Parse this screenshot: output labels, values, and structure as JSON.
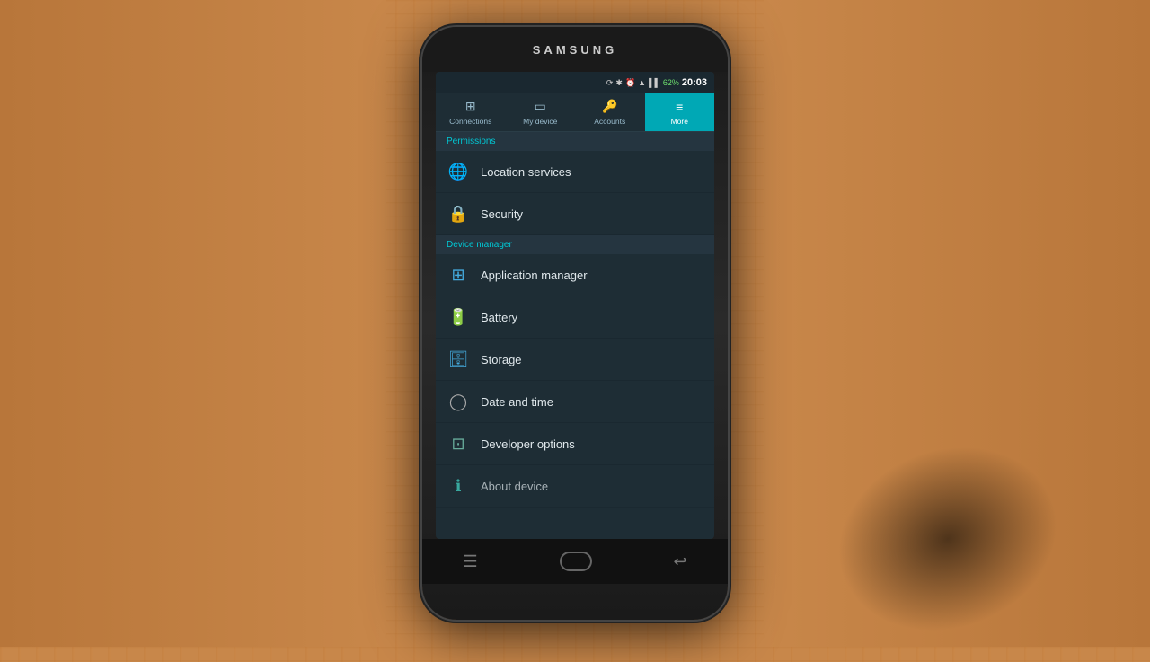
{
  "phone": {
    "brand": "SAMSUNG",
    "status_bar": {
      "time": "20:03",
      "battery": "62%",
      "icons": [
        "⊕",
        "✱",
        "◎",
        "▲",
        "▼"
      ]
    },
    "tabs": [
      {
        "id": "connections",
        "label": "Connections",
        "icon": "⊞",
        "active": false
      },
      {
        "id": "my_device",
        "label": "My device",
        "icon": "📱",
        "active": false
      },
      {
        "id": "accounts",
        "label": "Accounts",
        "icon": "🔑",
        "active": false
      },
      {
        "id": "more",
        "label": "More",
        "icon": "≡",
        "active": true
      }
    ],
    "sections": [
      {
        "header": "Permissions",
        "items": [
          {
            "id": "location",
            "label": "Location services",
            "icon": "🌐",
            "icon_class": "location-icon"
          },
          {
            "id": "security",
            "label": "Security",
            "icon": "🔒",
            "icon_class": "security-icon"
          }
        ]
      },
      {
        "header": "Device manager",
        "items": [
          {
            "id": "appmanager",
            "label": "Application manager",
            "icon": "⊞",
            "icon_class": "appmanager-icon"
          },
          {
            "id": "battery",
            "label": "Battery",
            "icon": "🔋",
            "icon_class": "battery-icn"
          },
          {
            "id": "storage",
            "label": "Storage",
            "icon": "🗄",
            "icon_class": "storage-icon"
          },
          {
            "id": "datetime",
            "label": "Date and time",
            "icon": "○",
            "icon_class": "datetime-icon"
          },
          {
            "id": "devopt",
            "label": "Developer options",
            "icon": "⊡",
            "icon_class": "devopt-icon"
          },
          {
            "id": "aboutdev",
            "label": "About device",
            "icon": "ℹ",
            "icon_class": "aboutdev-icon"
          }
        ]
      }
    ],
    "bottom_nav": {
      "menu": "☰",
      "back": "↩"
    }
  }
}
